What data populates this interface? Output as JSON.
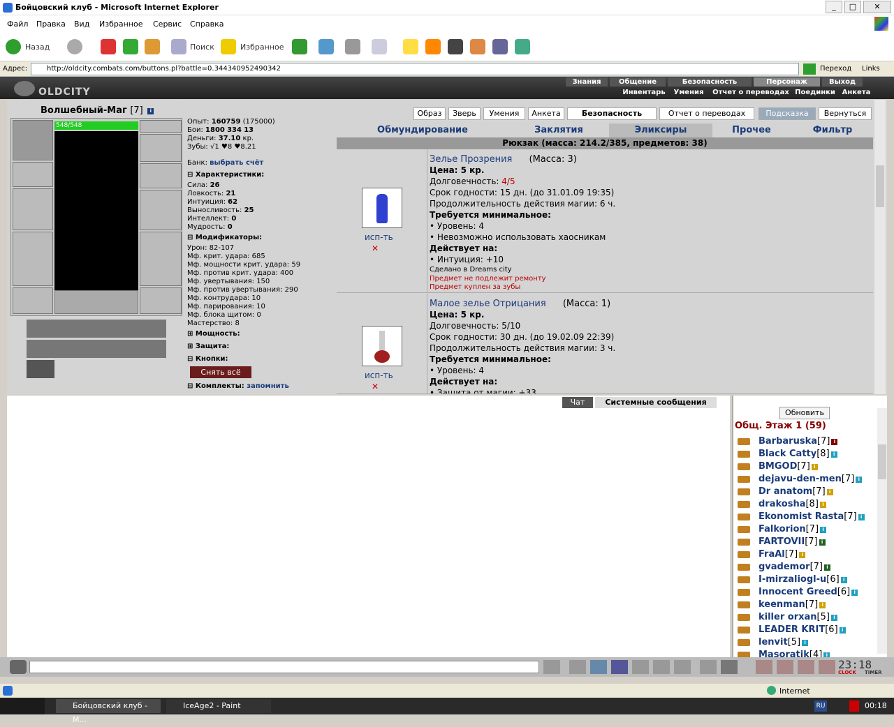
{
  "window": {
    "title": "Бойцовский клуб - Microsoft Internet Explorer"
  },
  "menu": [
    "Файл",
    "Правка",
    "Вид",
    "Избранное",
    "Сервис",
    "Справка"
  ],
  "toolbar": {
    "back": "Назад",
    "search": "Поиск",
    "favorites": "Избранное"
  },
  "address": {
    "label": "Адрес:",
    "url": "http://oldcity.combats.com/buttons.pl?battle=0.344340952490342",
    "go": "Переход",
    "links": "Links"
  },
  "game": {
    "logo": "OLDCITY",
    "nav_top": [
      "Знания",
      "Общение",
      "Безопасность",
      "Персонаж",
      "Выход"
    ],
    "nav_bottom": [
      "Инвентарь",
      "Умения",
      "Отчет о переводах",
      "Поединки",
      "Анкета"
    ]
  },
  "character": {
    "name": "Волшебный-Маг",
    "level": "[7]",
    "hp": "548/548",
    "exp_label": "Опыт:",
    "exp": "160759",
    "exp_next": "(175000)",
    "fights_label": "Бои:",
    "wins": "1800",
    "losses": "334",
    "draws": "13",
    "money_label": "Деньги:",
    "money": "37.10",
    "money_unit": "кр.",
    "teeth_label": "Зубы:",
    "teeth": "√1 ♥8 ♥8.21",
    "bank_label": "Банк:",
    "bank_link": "выбрать счёт",
    "sections": {
      "chars": "Характеристики:",
      "mods": "Модификаторы:",
      "power": "Мощность:",
      "defense": "Защита:",
      "buttons": "Кнопки:",
      "sets": "Комплекты:",
      "remember": "запомнить",
      "undress": "Снять всё"
    },
    "stats": [
      {
        "k": "Сила:",
        "v": "26"
      },
      {
        "k": "Ловкость:",
        "v": "21"
      },
      {
        "k": "Интуиция:",
        "v": "62"
      },
      {
        "k": "Выносливость:",
        "v": "25"
      },
      {
        "k": "Интеллект:",
        "v": "0"
      },
      {
        "k": "Мудрость:",
        "v": "0"
      }
    ],
    "mods": [
      "Урон: 82-107",
      "Мф. крит. удара: 685",
      "Мф. мощности крит. удара: 59",
      "Мф. против крит. удара: 400",
      "Мф. увертывания: 150",
      "Мф. против увертывания: 290",
      "Мф. контрудара: 10",
      "Мф. парирования: 10",
      "Мф. блока щитом: 0",
      "Мастерство: 8"
    ]
  },
  "buttons_top": [
    "Образ",
    "Зверь",
    "Умения",
    "Анкета",
    "Безопасность",
    "Отчет о переводах",
    "Подсказка",
    "Вернуться"
  ],
  "cat_tabs": [
    "Обмундирование",
    "Заклятия",
    "Эликсиры",
    "Прочее",
    "Фильтр"
  ],
  "rucksack": "Рюкзак (масса: 214.2/385, предметов: 38)",
  "items": [
    {
      "name": "Зелье Прозрения",
      "mass": "(Масса: 3)",
      "price": "Цена: 5 кр.",
      "dur_label": "Долговечность:",
      "dur": "4/5",
      "expiry": "Срок годности: 15 дн. (до 31.01.09 19:35)",
      "duration": "Продолжительность действия магии: 6 ч.",
      "req": "Требуется минимальное:",
      "req1": "• Уровень: 4",
      "req2": "• Невозможно использовать хаосникам",
      "acts": "Действует на:",
      "act1": "• Интуиция: +10",
      "made": "Сделано в Dreams city",
      "note1": "Предмет не подлежит ремонту",
      "note2": "Предмет куплен за зубы",
      "use": "исп-ть"
    },
    {
      "name": "Малое зелье Отрицания",
      "mass": "(Масса: 1)",
      "price": "Цена: 5 кр.",
      "dur_label": "Долговечность:",
      "dur": "5/10",
      "expiry": "Срок годности: 30 дн. (до 19.02.09 22:39)",
      "duration": "Продолжительность действия магии: 3 ч.",
      "req": "Требуется минимальное:",
      "req1": "• Уровень: 4",
      "acts": "Действует на:",
      "act1": "• Защита от магии: +33",
      "use": "исп-ть"
    }
  ],
  "chat": {
    "tab_chat": "Чат",
    "tab_sys": "Системные сообщения"
  },
  "online": {
    "refresh": "Обновить",
    "room": "Общ. Этаж 1 (59)",
    "users": [
      {
        "n": "Barbaruska",
        "l": "[7]",
        "c": "#800000"
      },
      {
        "n": "Black Catty",
        "l": "[8]",
        "c": "#20a0c0"
      },
      {
        "n": "BMGOD",
        "l": "[7]",
        "c": "#d0a000"
      },
      {
        "n": "dejavu-den-men",
        "l": "[7]",
        "c": "#20a0c0"
      },
      {
        "n": "Dr anatom",
        "l": "[7]",
        "c": "#d0a000"
      },
      {
        "n": "drakosha",
        "l": "[8]",
        "c": "#d0a000"
      },
      {
        "n": "Ekonomist Rasta",
        "l": "[7]",
        "c": "#20a0c0"
      },
      {
        "n": "Falkorion",
        "l": "[7]",
        "c": "#20a0c0"
      },
      {
        "n": "FARTOVII",
        "l": "[7]",
        "c": "#206020"
      },
      {
        "n": "FraAl",
        "l": "[7]",
        "c": "#d0a000"
      },
      {
        "n": "gvademor",
        "l": "[7]",
        "c": "#206020"
      },
      {
        "n": "I-mirzaliogl-u",
        "l": "[6]",
        "c": "#20a0c0"
      },
      {
        "n": "Innocent Greed",
        "l": "[6]",
        "c": "#20a0c0"
      },
      {
        "n": "keenman",
        "l": "[7]",
        "c": "#d0a000"
      },
      {
        "n": "killer orxan",
        "l": "[5]",
        "c": "#20a0c0"
      },
      {
        "n": "LEADER KRIT",
        "l": "[6]",
        "c": "#20a0c0"
      },
      {
        "n": "lenvit",
        "l": "[5]",
        "c": "#20a0c0"
      },
      {
        "n": "Masoratik",
        "l": "[4]",
        "c": "#20a0c0"
      }
    ]
  },
  "clock": {
    "time": "23:18",
    "label1": "CLOCK",
    "label2": "TIMER"
  },
  "status": {
    "zone": "Internet"
  },
  "taskbar": {
    "task1": "Бойцовский клуб - M...",
    "task2": "IceAge2 - Paint",
    "lang": "RU",
    "time": "00:18"
  }
}
